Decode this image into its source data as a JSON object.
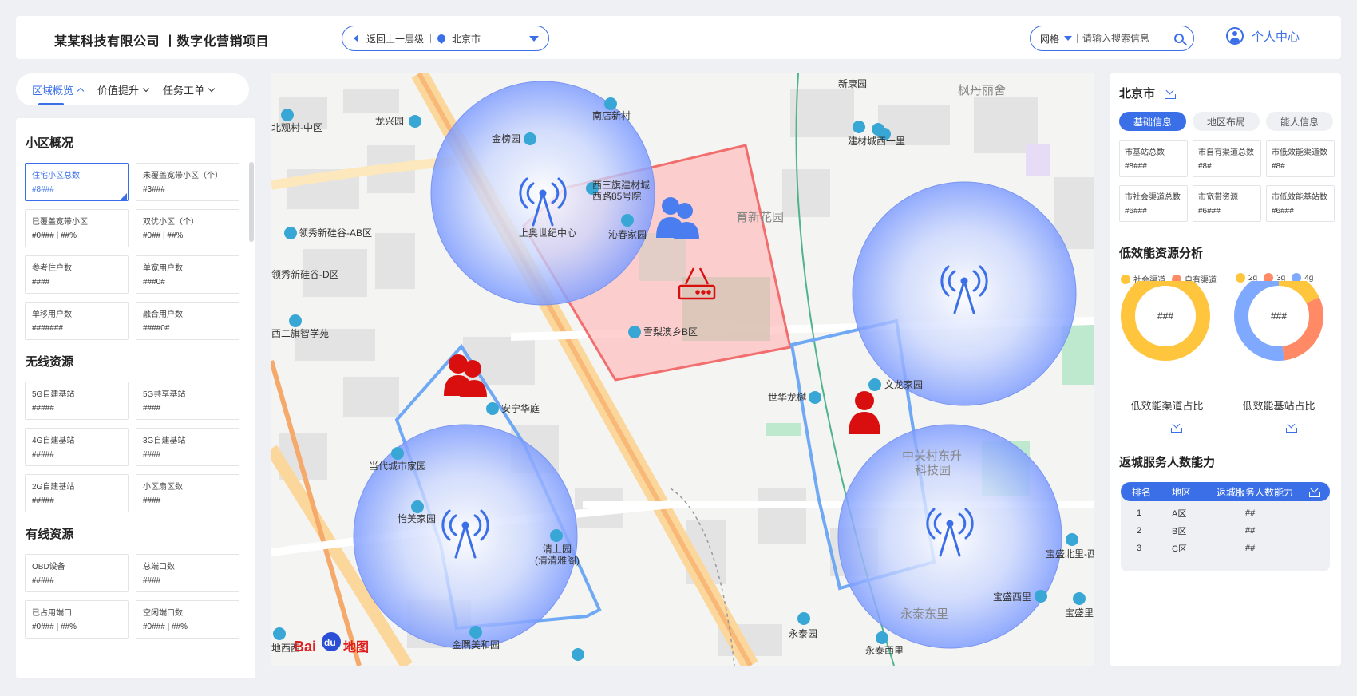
{
  "header": {
    "company": "某某科技有限公司 丨数字化营销项目",
    "back_label": "返回上一层级",
    "city": "北京市",
    "grid_label": "网格",
    "search_placeholder": "请输入搜索信息",
    "user_center": "个人中心"
  },
  "left_tabs": [
    {
      "label": "区域概览",
      "active": true
    },
    {
      "label": "价值提升",
      "active": false
    },
    {
      "label": "任务工单",
      "active": false
    }
  ],
  "sections": [
    {
      "title": "小区概况",
      "cards": [
        {
          "label": "住宅小区总数",
          "value": "#8###"
        },
        {
          "label": "未覆盖宽带小区（个）",
          "value": "#3###"
        },
        {
          "label": "已覆盖宽带小区",
          "value": "#0### | ##%"
        },
        {
          "label": "双优小区（个）",
          "value": "#0## | ##%"
        },
        {
          "label": "参考住户数",
          "value": "####"
        },
        {
          "label": "单宽用户数",
          "value": "###0#"
        },
        {
          "label": "单移用户数",
          "value": "#######"
        },
        {
          "label": "融合用户数",
          "value": "####0#"
        }
      ]
    },
    {
      "title": "无线资源",
      "cards": [
        {
          "label": "5G自建基站",
          "value": "#####"
        },
        {
          "label": "5G共享基站",
          "value": "####"
        },
        {
          "label": "4G自建基站",
          "value": "#####"
        },
        {
          "label": "3G自建基站",
          "value": "####"
        },
        {
          "label": "2G自建基站",
          "value": "#####"
        },
        {
          "label": "小区扇区数",
          "value": "####"
        }
      ]
    },
    {
      "title": "有线资源",
      "cards": [
        {
          "label": "OBD设备",
          "value": "#####"
        },
        {
          "label": "总端口数",
          "value": "####"
        },
        {
          "label": "已占用端口",
          "value": "#0### | ##%"
        },
        {
          "label": "空闲端口数",
          "value": "#0### | ##%"
        }
      ]
    }
  ],
  "map": {
    "labels": [
      "新康园",
      "枫丹丽舍",
      "南店新村",
      "龙兴园",
      "金榜园",
      "北观村-中区",
      "建材城西一里",
      "西三旗建材城",
      "西路85号院",
      "上奥世纪中心",
      "沁春家园",
      "育新花园",
      "领秀新硅谷-AB区",
      "领秀新硅谷-D区",
      "西二旗智学苑",
      "雪梨澳乡B区",
      "安宁华庭",
      "世华龙樾",
      "文龙家园",
      "中关村东升",
      "科技园",
      "当代城市家园",
      "怡美家园",
      "清上园",
      "(清清雅阁)",
      "宝盛北里-西",
      "宝盛西里",
      "宝盛里",
      "永泰东里",
      "永泰园",
      "永泰西里",
      "金隅美和园",
      "地西西"
    ],
    "logo_bai": "Bai",
    "logo_du": "du",
    "logo_map": "地图"
  },
  "right": {
    "title": "北京市",
    "tabs": [
      {
        "label": "基础信息",
        "active": true
      },
      {
        "label": "地区布局",
        "active": false
      },
      {
        "label": "能人信息",
        "active": false
      }
    ],
    "cards": [
      {
        "label": "市基站总数",
        "value": "#8###"
      },
      {
        "label": "市自有渠道总数",
        "value": "#8#"
      },
      {
        "label": "市低效能渠道数",
        "value": "#8#"
      },
      {
        "label": "市社会渠道总数",
        "value": "#6###"
      },
      {
        "label": "市宽带资源",
        "value": "#6###"
      },
      {
        "label": "市低效能基站数",
        "value": "#6###"
      }
    ],
    "analysis_title": "低效能资源分析",
    "legend1": [
      {
        "label": "社会渠道",
        "color": "#ffc53d"
      },
      {
        "label": "自有渠道",
        "color": "#ff8a65"
      }
    ],
    "legend2": [
      {
        "label": "2g",
        "color": "#ffc53d"
      },
      {
        "label": "3g",
        "color": "#ff8a65"
      },
      {
        "label": "4g",
        "color": "#7fa8ff"
      }
    ],
    "donut1": {
      "center": "###",
      "caption": "低效能渠道占比",
      "shares": [
        1.0,
        0.0
      ]
    },
    "donut2": {
      "center": "###",
      "caption": "低效能基站占比",
      "shares": [
        0.18,
        0.3,
        0.52
      ]
    },
    "ability_title": "返城服务人数能力",
    "table_headers": [
      "排名",
      "地区",
      "返城服务人数能力"
    ],
    "table_rows": [
      {
        "rank": "1",
        "area": "A区",
        "value": "##"
      },
      {
        "rank": "2",
        "area": "B区",
        "value": "##"
      },
      {
        "rank": "3",
        "area": "C区",
        "value": "##"
      }
    ]
  },
  "colors": {
    "accent": "#3a6fe8",
    "coverage": "#7f9dff",
    "zone_red": "#ff6b6b",
    "zone_blue": "#6fa8f5",
    "user_red": "#d90f0f",
    "user_blue": "#4a7df0"
  }
}
